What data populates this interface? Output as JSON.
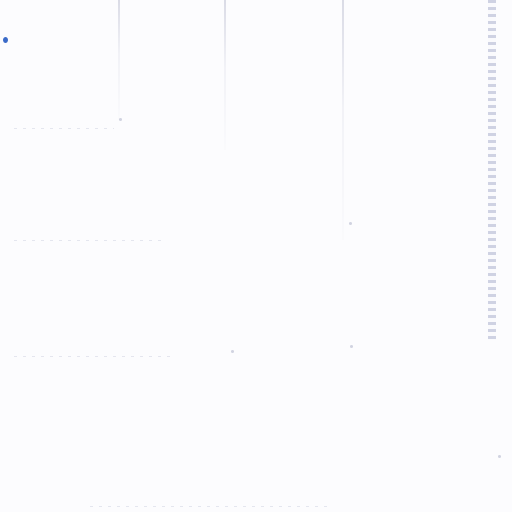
{
  "screen": {
    "accent": "#3a6ac8",
    "background": "#fcfcfe",
    "icons": [
      "cursor-mark-icon"
    ]
  }
}
